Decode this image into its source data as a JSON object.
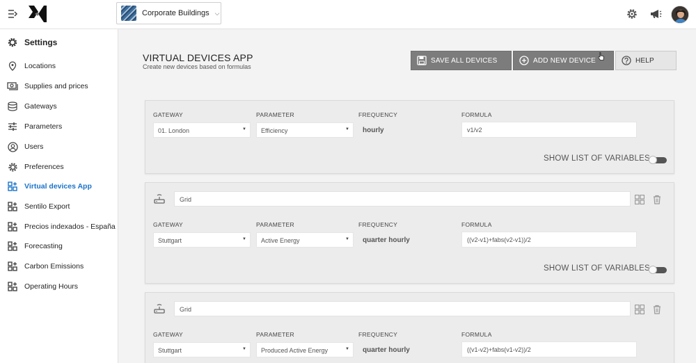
{
  "header": {
    "site_name": "Corporate Buildings"
  },
  "sidebar": {
    "title": "Settings",
    "items": [
      {
        "label": "Locations",
        "icon": "location-pin-icon"
      },
      {
        "label": "Supplies and prices",
        "icon": "money-icon"
      },
      {
        "label": "Gateways",
        "icon": "database-icon"
      },
      {
        "label": "Parameters",
        "icon": "sliders-icon"
      },
      {
        "label": "Users",
        "icon": "user-circle-icon"
      },
      {
        "label": "Preferences",
        "icon": "gear-icon"
      },
      {
        "label": "Virtual devices App",
        "icon": "apps-icon",
        "active": true
      },
      {
        "label": "Sentilo Export",
        "icon": "apps-icon"
      },
      {
        "label": "Precios indexados - España",
        "icon": "apps-icon"
      },
      {
        "label": "Forecasting",
        "icon": "apps-icon"
      },
      {
        "label": "Carbon Emissions",
        "icon": "apps-icon"
      },
      {
        "label": "Operating Hours",
        "icon": "apps-icon"
      }
    ]
  },
  "main": {
    "title": "VIRTUAL DEVICES APP",
    "subtitle": "Create new devices based on formulas",
    "buttons": {
      "save_all": "SAVE ALL DEVICES",
      "add_new": "ADD NEW DEVICE",
      "help": "HELP"
    },
    "labels": {
      "gateway": "GATEWAY",
      "parameter": "PARAMETER",
      "frequency": "FREQUENCY",
      "formula": "FORMULA",
      "show_vars": "SHOW LIST OF VARIABLES"
    },
    "devices": [
      {
        "name": "",
        "gateway": "01. London",
        "parameter": "Efficiency",
        "frequency": "hourly",
        "formula": "v1/v2"
      },
      {
        "name": "Grid",
        "gateway": "Stuttgart",
        "parameter": "Active Energy",
        "frequency": "quarter hourly",
        "formula": "((v2-v1)+fabs(v2-v1))/2"
      },
      {
        "name": "Grid",
        "gateway": "Stuttgart",
        "parameter": "Produced Active Energy",
        "frequency": "quarter hourly",
        "formula": "((v1-v2)+fabs(v1-v2))/2"
      }
    ]
  },
  "colors": {
    "accent": "#1a73c9",
    "button_dark": "#7c7c7c",
    "button_light": "#e6e6e6",
    "card_bg": "#ececec"
  }
}
